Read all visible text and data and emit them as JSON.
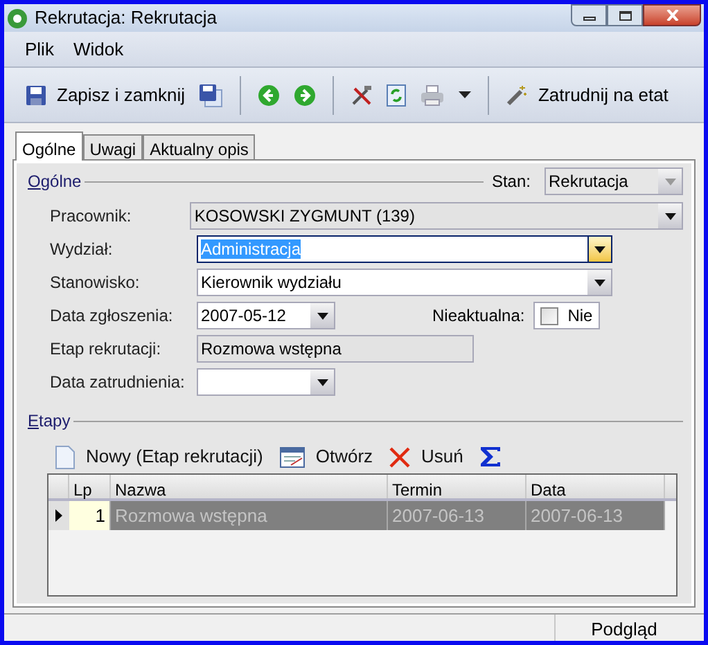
{
  "window": {
    "title": "Rekrutacja: Rekrutacja"
  },
  "menu": [
    "Plik",
    "Widok"
  ],
  "toolbar": [
    {
      "kind": "button",
      "label": "Zapisz i zamknij"
    },
    {
      "kind": "icon"
    },
    {
      "kind": "separator"
    },
    {
      "kind": "icon"
    },
    {
      "kind": "icon"
    },
    {
      "kind": "separator"
    },
    {
      "kind": "icon"
    },
    {
      "kind": "icon"
    },
    {
      "kind": "icon"
    },
    {
      "kind": "icon"
    },
    {
      "kind": "separator"
    },
    {
      "kind": "button",
      "label": "Zatrudnij na etat"
    }
  ],
  "tabs": [
    {
      "label": "Ogólne",
      "selected": true
    },
    {
      "label": "Uwagi",
      "selected": false
    },
    {
      "label": "Aktualny opis",
      "selected": false
    }
  ],
  "general": {
    "title": "Ogólne",
    "stan_label": "Stan:",
    "stan_value": "Rekrutacja",
    "stan_disabled": true,
    "fields": [
      {
        "label": "Pracownik:",
        "value": "KOSOWSKI ZYGMUNT (139)",
        "kind": "combo",
        "readonly": true,
        "focused": false
      },
      {
        "label": "Wydział:",
        "value": "Administracja",
        "kind": "combo",
        "readonly": false,
        "focused": true
      },
      {
        "label": "Stanowisko:",
        "value": "Kierownik wydziału",
        "kind": "combo",
        "readonly": false,
        "focused": false
      },
      {
        "label": "Data zgłoszenia:",
        "value": "2007-05-12",
        "kind": "combo",
        "readonly": false,
        "focused": false,
        "aside": {
          "label": "Nieaktualna:",
          "text": "Nie",
          "checked": false
        }
      },
      {
        "label": "Etap rekrutacji:",
        "value": "Rozmowa wstępna",
        "kind": "text",
        "readonly": true,
        "focused": false
      },
      {
        "label": "Data zatrudnienia:",
        "kind": "combo",
        "readonly": false,
        "focused": false
      }
    ]
  },
  "stages": {
    "title": "Etapy",
    "actions": [
      {
        "kind": "button",
        "label": "Nowy (Etap rekrutacji)"
      },
      {
        "kind": "button",
        "label": "Otwórz"
      },
      {
        "kind": "button",
        "label": "Usuń"
      },
      {
        "kind": "icon"
      }
    ],
    "columns": [
      "Lp",
      "Nazwa",
      "Termin",
      "Data"
    ],
    "rows": [
      {
        "cells": [
          "1",
          "Rozmowa wstępna",
          "2007-06-13",
          "2007-06-13"
        ],
        "selected": true
      }
    ]
  },
  "status_bar": [
    "Podgląd"
  ]
}
